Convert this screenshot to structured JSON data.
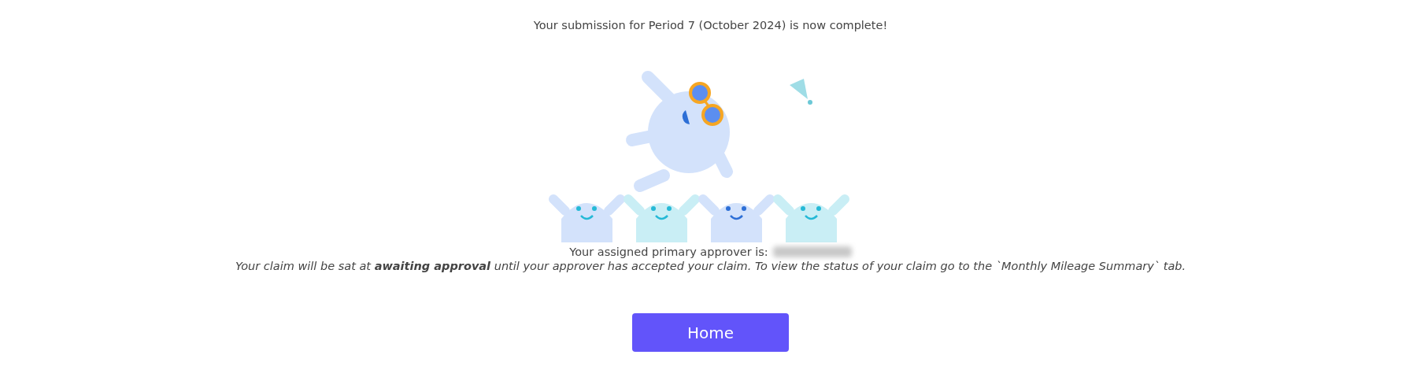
{
  "heading": "Your submission for Period 7 (October 2024) is now complete!",
  "approver": {
    "label": "Your assigned primary approver is:",
    "name_redacted": true
  },
  "note": "Your claim will be sat at **awaiting approval** until your approver has accepted your claim. To view the status of your claim go to the `Monthly Mileage Summary` tab.",
  "button": {
    "label": "Home"
  }
}
